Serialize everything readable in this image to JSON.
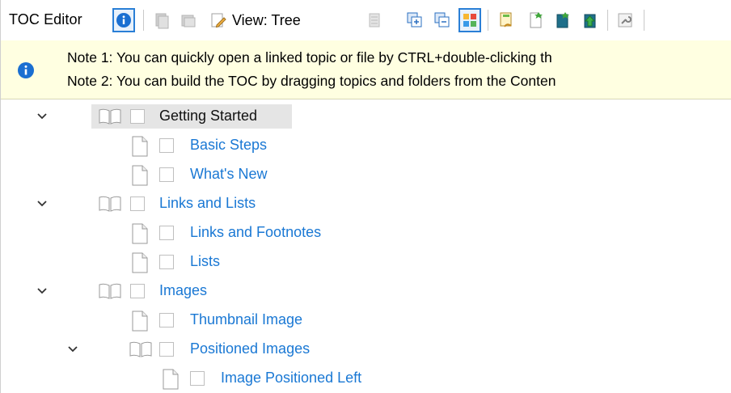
{
  "toolbar": {
    "title": "TOC Editor",
    "view_label": "View: Tree"
  },
  "banner": {
    "note1": "Note 1: You can quickly open a linked topic or file by CTRL+double-clicking th",
    "note2": "Note 2: You can build the TOC by dragging topics and folders from the Conten"
  },
  "tree": {
    "items": [
      {
        "label": "Getting Started",
        "type": "book",
        "level": 0,
        "expanded": true,
        "selected": true
      },
      {
        "label": "Basic Steps",
        "type": "page",
        "level": 1
      },
      {
        "label": "What's New",
        "type": "page",
        "level": 1
      },
      {
        "label": "Links and Lists",
        "type": "book",
        "level": 0,
        "expanded": true
      },
      {
        "label": "Links and Footnotes",
        "type": "page",
        "level": 1
      },
      {
        "label": "Lists",
        "type": "page",
        "level": 1
      },
      {
        "label": "Images",
        "type": "book",
        "level": 0,
        "expanded": true
      },
      {
        "label": "Thumbnail Image",
        "type": "page",
        "level": 1
      },
      {
        "label": "Positioned Images",
        "type": "book",
        "level": 1,
        "expanded": true
      },
      {
        "label": "Image Positioned Left",
        "type": "page",
        "level": 2
      }
    ]
  },
  "colors": {
    "link": "#1a78d4",
    "info_blue": "#1a6fd1",
    "banner_bg": "#ffffe1",
    "selection": "#e5e5e5"
  }
}
